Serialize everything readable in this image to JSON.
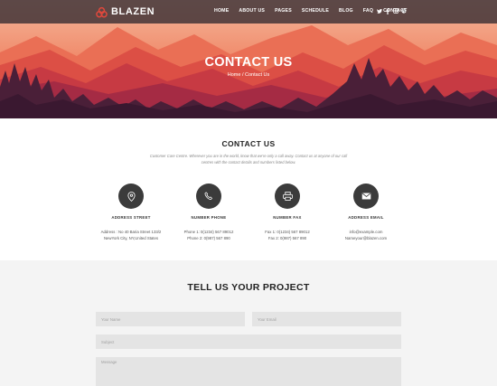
{
  "brand": {
    "name": "BLAZEN",
    "accent": "#e0483c"
  },
  "nav": {
    "items": [
      "HOME",
      "ABOUT US",
      "PAGES",
      "SCHEDULE",
      "BLOG",
      "FAQ",
      "CONTACT"
    ],
    "social_icons": [
      "twitter-icon",
      "facebook-icon",
      "instagram-icon",
      "dribbble-icon"
    ]
  },
  "hero": {
    "title": "CONTACT US",
    "breadcrumb": {
      "home": "Home",
      "separator": "/",
      "current": "Contact Us"
    }
  },
  "contact": {
    "title": "CONTACT US",
    "description": "Customer Care Centre. Wherever you are in the world, know that we're only a call away. Contact us at anyone of our call centres with the contact details and numbers listed below.",
    "cards": [
      {
        "icon": "location-pin-icon",
        "label": "ADDRESS STREET",
        "line1": "Address : No 40 Baria Street 133/2",
        "line2": "NewYork City, NY,United States"
      },
      {
        "icon": "phone-icon",
        "label": "NUMBER PHONE",
        "line1": "Phone 1: 0(1234) 567 89012",
        "line2": "Phone 2: 0(987) 567 890"
      },
      {
        "icon": "fax-icon",
        "label": "NUMBER FAX",
        "line1": "Fax 1: 0(1234) 567 89012",
        "line2": "Fax 2: 0(987) 567 890"
      },
      {
        "icon": "envelope-icon",
        "label": "ADDRESS EMAIL",
        "line1": "info@example.com",
        "line2": "Nameyour@blazen.com"
      }
    ]
  },
  "project": {
    "title": "TELL US YOUR PROJECT",
    "name_placeholder": "Your Name",
    "email_placeholder": "Your Email",
    "subject_placeholder": "Subject",
    "message_placeholder": "Message"
  }
}
